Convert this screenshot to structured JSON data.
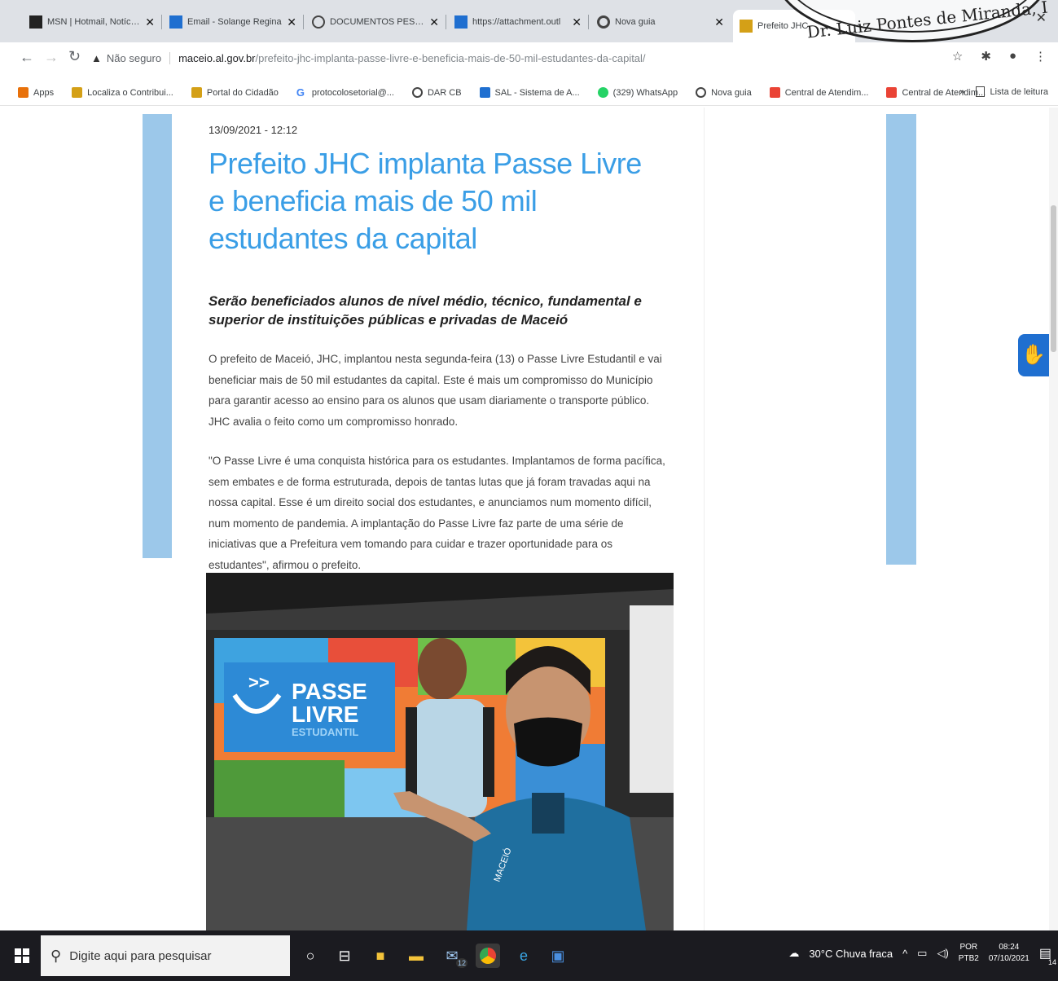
{
  "browser": {
    "tabs": [
      {
        "label": "MSN | Hotmail, Notícias",
        "icon": "msn-icon",
        "color": "#222222"
      },
      {
        "label": "Email - Solange Regina",
        "icon": "outlook-icon",
        "color": "#1f6fd0"
      },
      {
        "label": "DOCUMENTOS PESSOAIS",
        "icon": "globe-icon",
        "color": "#444444"
      },
      {
        "label": "https://attachment.outl",
        "icon": "outlook-icon",
        "color": "#1f6fd0"
      },
      {
        "label": "Nova guia",
        "icon": "chrome-icon",
        "color": "#444444"
      },
      {
        "label": "Prefeito JHC",
        "icon": "prefeitura-icon",
        "color": "#d4a017",
        "active": true
      }
    ],
    "address": {
      "warning": "Não seguro",
      "host": "maceio.al.gov.br",
      "path": "/prefeito-jhc-implanta-passe-livre-e-beneficia-mais-de-50-mil-estudantes-da-capital/"
    },
    "bookmarks": [
      {
        "label": "Apps",
        "color": "#e8710a"
      },
      {
        "label": "Localiza o Contribui...",
        "color": "#d4a017"
      },
      {
        "label": "Portal do Cidadão",
        "color": "#d4a017"
      },
      {
        "label": "protocolosetorial@...",
        "color": "#4285f4"
      },
      {
        "label": "DAR CB",
        "color": "#444444"
      },
      {
        "label": "SAL - Sistema de A...",
        "color": "#1f6fd0"
      },
      {
        "label": "(329) WhatsApp",
        "color": "#25d366"
      },
      {
        "label": "Nova guia",
        "color": "#444444"
      },
      {
        "label": "Central de Atendim...",
        "color": "#ea4335"
      },
      {
        "label": "Central de Atendim...",
        "color": "#ea4335"
      }
    ],
    "bookmarks_more": "»",
    "reading_list": "Lista de leitura"
  },
  "seal": {
    "text": "Dr. Luiz Pontes de Miranda, I"
  },
  "article": {
    "date": "13/09/2021 - 12:12",
    "title": "Prefeito JHC implanta Passe Livre e beneficia mais de 50 mil estudantes da capital",
    "subtitle": "Serão beneficiados alunos de nível médio, técnico, fundamental e superior de instituições públicas e privadas de Maceió",
    "paragraph1": "O prefeito de Maceió, JHC, implantou nesta segunda-feira (13) o Passe Livre Estudantil e vai beneficiar mais de 50 mil estudantes da capital. Este é mais um compromisso do Município para garantir acesso ao ensino para os alunos que usam diariamente o transporte público. JHC avalia o feito como um compromisso honrado.",
    "paragraph2": "\"O Passe Livre é uma conquista histórica para os estudantes. Implantamos de forma pacífica, sem embates e de forma estruturada, depois de tantas lutas que já foram travadas aqui na nossa capital. Esse é um direito social dos estudantes, e anunciamos num momento difícil, num momento de pandemia. A implantação do Passe Livre faz parte de uma série de iniciativas que a Prefeitura vem tomando para cuidar e trazer oportunidade para os estudantes\", afirmou o prefeito.",
    "photo": {
      "banner_line1": "PASSE",
      "banner_line2": "LIVRE",
      "banner_line3": "ESTUDANTIL",
      "vest_text": "MACEIÓ"
    }
  },
  "taskbar": {
    "search_placeholder": "Digite aqui para pesquisar",
    "weather": "30°C Chuva fraca",
    "lang_top": "POR",
    "lang_bottom": "PTB2",
    "time": "08:24",
    "date": "07/10/2021",
    "mail_badge": "12",
    "notif_badge": "14"
  }
}
